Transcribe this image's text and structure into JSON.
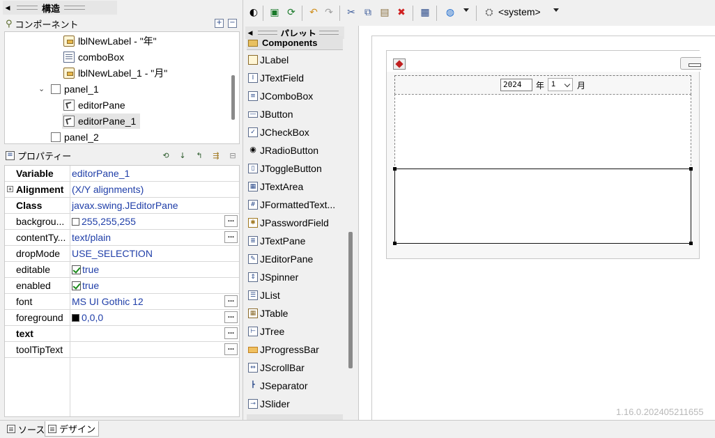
{
  "structure": {
    "title": "構造",
    "components_label": "コンポーネント",
    "tree": [
      {
        "label": "lblNewLabel - \"年\"",
        "icon": "label-icon"
      },
      {
        "label": "comboBox",
        "icon": "combobox-icon"
      },
      {
        "label": "lblNewLabel_1 - \"月\"",
        "icon": "label-icon"
      },
      {
        "label": "panel_1",
        "icon": "panel-icon"
      },
      {
        "label": "editorPane",
        "icon": "editor-pane-icon"
      },
      {
        "label": "editorPane_1",
        "icon": "editor-pane-icon"
      },
      {
        "label": "panel_2",
        "icon": "panel-icon"
      }
    ]
  },
  "properties": {
    "title": "プロパティー",
    "rows": [
      {
        "name": "Variable",
        "value": "editorPane_1"
      },
      {
        "name": "Alignment",
        "value": "(X/Y alignments)"
      },
      {
        "name": "Class",
        "value": "javax.swing.JEditorPane"
      },
      {
        "name": "backgrou...",
        "value": "255,255,255"
      },
      {
        "name": "contentTy...",
        "value": "text/plain"
      },
      {
        "name": "dropMode",
        "value": "USE_SELECTION"
      },
      {
        "name": "editable",
        "value": "true"
      },
      {
        "name": "enabled",
        "value": "true"
      },
      {
        "name": "font",
        "value": "MS UI Gothic 12"
      },
      {
        "name": "foreground",
        "value": "0,0,0"
      },
      {
        "name": "text",
        "value": ""
      },
      {
        "name": "toolTipText",
        "value": ""
      }
    ],
    "ellipsis": "..."
  },
  "toolbar": {
    "system_label": "<system>"
  },
  "palette": {
    "title": "パレット",
    "category": "Components",
    "items": [
      "JLabel",
      "JTextField",
      "JComboBox",
      "JButton",
      "JCheckBox",
      "JRadioButton",
      "JToggleButton",
      "JTextArea",
      "JFormattedText...",
      "JPasswordField",
      "JTextPane",
      "JEditorPane",
      "JSpinner",
      "JList",
      "JTable",
      "JTree",
      "JProgressBar",
      "JScrollBar",
      "JSeparator",
      "JSlider"
    ]
  },
  "design": {
    "year_value": "2024",
    "year_label": "年",
    "month_value": "1",
    "month_label": "月"
  },
  "bottom_tabs": {
    "source": "ソース",
    "design": "デザイン"
  },
  "version": "1.16.0.202405211655",
  "colors": {
    "link_blue": "#1f3ea8",
    "selection": "#e5e5e5",
    "foreground_swatch": "#000000",
    "background_swatch": "#ffffff"
  }
}
